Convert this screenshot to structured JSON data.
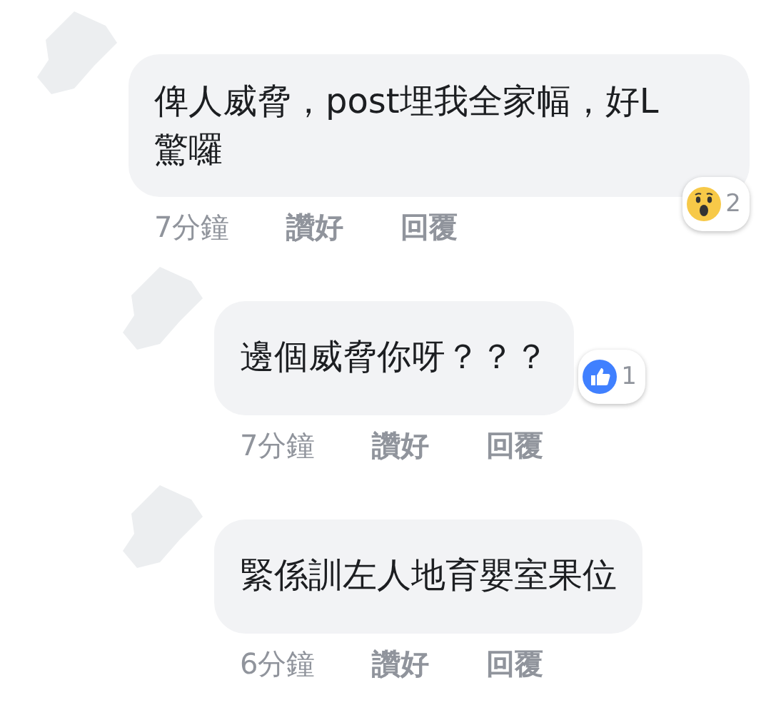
{
  "comments": [
    {
      "text": "俾人威脅，post埋我全家幅，好L驚囉",
      "time": "7分鐘",
      "like": "讚好",
      "reply": "回覆",
      "reaction": {
        "kind": "wow",
        "count": "2"
      },
      "children": [
        {
          "text": "邊個威脅你呀？？？",
          "time": "7分鐘",
          "like": "讚好",
          "reply": "回覆",
          "reaction": {
            "kind": "like",
            "count": "1"
          }
        },
        {
          "text": "緊係訓左人地育嬰室果位",
          "time": "6分鐘",
          "like": "讚好",
          "reply": "回覆"
        }
      ]
    }
  ]
}
